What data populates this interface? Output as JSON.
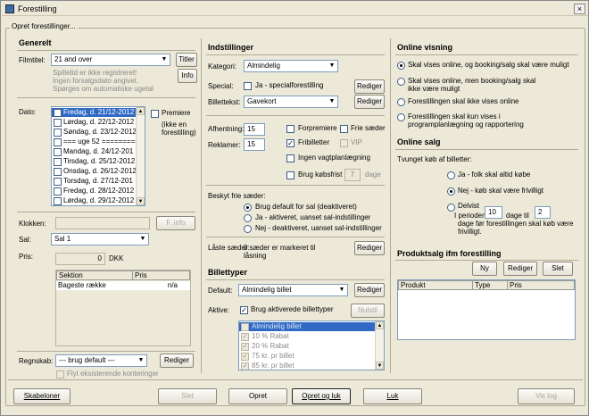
{
  "window": {
    "title": "Forestilling",
    "close": "×"
  },
  "group_label": "Opret forestillinger...",
  "generelt": {
    "title": "Generelt",
    "filmtitel_label": "Filmtitel:",
    "filmtitel_value": "21 and over",
    "titler_button": "Titler",
    "info_text": [
      "Spilletid er ikke registreret!",
      "Ingen forsalgsdato angivet.",
      "Spørges om automatiske ugetal"
    ],
    "info_button": "Info",
    "dato_label": "Dato:",
    "dates": [
      "Fredag, d. 21/12-2012",
      "Lørdag, d. 22/12-2012",
      "Søndag, d. 23/12-2012",
      "=== uge 52 ==========",
      "Mandag, d. 24/12-201",
      "Tirsdag, d. 25/12-2012",
      "Onsdag, d. 26/12-2012",
      "Torsdag, d. 27/12-201",
      "Fredag, d. 28/12-2012",
      "Lørdag, d. 29/12-2012"
    ],
    "premiere_label": "Premiere",
    "premiere_note": "(ikke en forestilling)",
    "klokken_label": "Klokken:",
    "finfo_button": "F. info",
    "sal_label": "Sal:",
    "sal_value": "Sal 1",
    "pris_label": "Pris:",
    "pris_value": "0",
    "pris_unit": "DKK",
    "price_table": {
      "headers": [
        "Sektion",
        "Pris"
      ],
      "rows": [
        [
          "Bageste række",
          "n/a"
        ]
      ]
    },
    "regnskab_label": "Regnskab:",
    "regnskab_value": "--- brug default ---",
    "regnskab_button": "Rediger",
    "flyt_label": "Flyt eksisterende konteringer"
  },
  "indstillinger": {
    "title": "Indstillinger",
    "kategori_label": "Kategori:",
    "kategori_value": "Almindelig",
    "special_label": "Special:",
    "special_cb_label": "Ja - specialforestilling",
    "special_button": "Rediger",
    "billettekst_label": "Billettekst:",
    "billettekst_value": "Gavekort",
    "billettekst_button": "Rediger",
    "afhentning_label": "Afhentning:",
    "afhentning_value": "15",
    "reklamer_label": "Reklamer:",
    "reklamer_value": "15",
    "forpremiere": "Forpremiere",
    "frie_saeder": "Frie sæder",
    "fribilletter": "Fribilletter",
    "vip": "VIP",
    "ingen_vagt": "Ingen vagtplanlægning",
    "brug_kobsfrist": "Brug købsfrist",
    "kobsfrist_value": "7",
    "dage": "dage",
    "beskyt_label": "Beskyt frie sæder:",
    "beskyt_options": [
      "Brug default for sal (deaktiveret)",
      "Ja - aktiveret, uanset sal-indstillinger",
      "Nej - deaktiveret, uanset sal-indstillinger"
    ],
    "laaste_label": "Låste sæder:",
    "laaste_text": "0 sæder er markeret til låsning",
    "laaste_button": "Rediger"
  },
  "billettyper": {
    "title": "Billettyper",
    "default_label": "Default:",
    "default_value": "Almindelig billet",
    "default_button": "Rediger",
    "aktive_label": "Aktive:",
    "brug_aktiverede": "Brug aktiverede billettyper",
    "nulstil_button": "Nulstil",
    "types": [
      "Almindelig billet",
      "10 % Rabat",
      "20 % Rabat",
      "75 kr. pr billet",
      "85 kr. pr billet"
    ]
  },
  "online_visning": {
    "title": "Online visning",
    "options": [
      "Skal vises online, og booking/salg skal være muligt",
      "Skal vises online, men booking/salg skal ikke være muligt",
      "Forestillingen skal ikke vises online",
      "Forestillingen skal kun vises i programplanlægning og rapportering"
    ]
  },
  "online_salg": {
    "title": "Online salg",
    "tvunget_label": "Tvunget køb af billetter:",
    "options": [
      "Ja - folk skal altid købe",
      "Nej - køb skal være frivilligt",
      "Delvist"
    ],
    "delvist_text1": "I perioden",
    "delvist_val1": "10",
    "delvist_text2": "dage til",
    "delvist_val2": "2",
    "delvist_text3": "dage før forestillingen skal køb være frivilligt."
  },
  "produktsalg": {
    "title": "Produktsalg ifm forestilling",
    "ny_button": "Ny",
    "rediger_button": "Rediger",
    "slet_button": "Slet",
    "headers": [
      "Produkt",
      "Type",
      "Pris"
    ]
  },
  "footer": {
    "skabeloner": "Skabeloner",
    "slet": "Slet",
    "opret": "Opret",
    "opret_luk": "Opret og luk",
    "luk": "Luk",
    "vis_log": "Vis log"
  }
}
